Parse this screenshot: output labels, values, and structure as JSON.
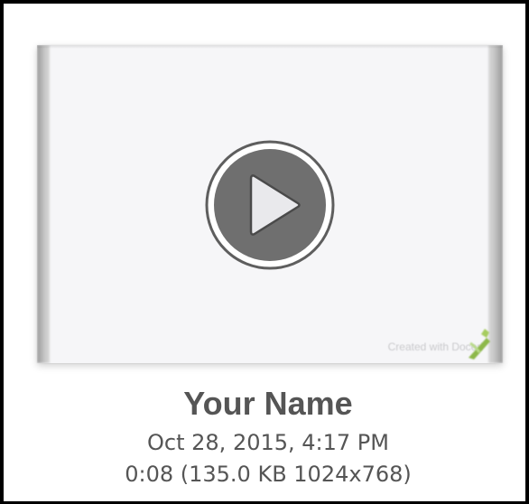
{
  "media_item": {
    "watermark_text": "Created with Doceri",
    "title": "Your Name",
    "date": "Oct 28, 2015, 4:17 PM",
    "details": "0:08 (135.0 KB 1024x768)"
  },
  "icons": {
    "play": "play-icon",
    "watermark_logo": "doceri-logo-icon"
  },
  "colors": {
    "text": "#555555",
    "thumbnail_background": "#f6f6f8",
    "play_circle": "#6f6f6f",
    "play_triangle": "#e9e9ec",
    "logo_green": "#8db84a"
  }
}
